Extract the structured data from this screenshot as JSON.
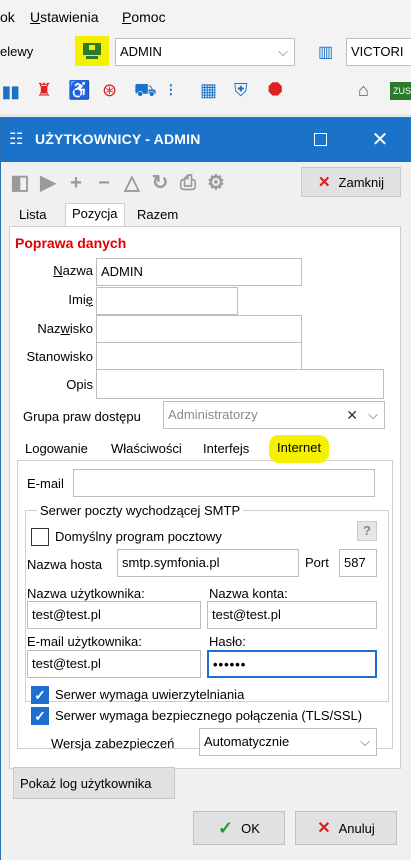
{
  "menubar": {
    "items": [
      "ok",
      "Ustawienia",
      "Pomoc"
    ],
    "underline_index": [
      null,
      0,
      0
    ]
  },
  "app_toolbar": {
    "left_label": "elewy",
    "user_select": "ADMIN",
    "company_select": "VICTORI"
  },
  "app_iconbar": {
    "icons": [
      "chart-icon",
      "extinguisher-icon",
      "accessibility-icon",
      "lifebuoy-icon",
      "car-icon",
      "footsteps-icon",
      "grid-icon",
      "shield-icon",
      "stop-sign-icon"
    ],
    "right_icons": [
      "bank-icon",
      "zus-icon"
    ]
  },
  "dialog": {
    "title": "UŻYTKOWNICY - ADMIN",
    "close_label": "Zamknij",
    "tabs": [
      "Lista",
      "Pozycja",
      "Razem"
    ],
    "active_tab": "Pozycja",
    "section_title": "Poprawa danych",
    "fields": {
      "nazwa": {
        "label": "Nazwa",
        "value": "ADMIN"
      },
      "imie": {
        "label": "Imię",
        "value": ""
      },
      "nazwisko": {
        "label": "Nazwisko",
        "value": ""
      },
      "stanowisko": {
        "label": "Stanowisko",
        "value": ""
      },
      "opis": {
        "label": "Opis",
        "value": ""
      }
    },
    "grupa": {
      "label": "Grupa praw dostępu",
      "value": "Administratorzy"
    },
    "subtabs": [
      "Logowanie",
      "Właściwości",
      "Interfejs",
      "Internet"
    ],
    "active_subtab": "Internet",
    "internet": {
      "email_label": "E-mail",
      "email_value": "",
      "smtp_group_title": "Serwer poczty wychodzącej SMTP",
      "default_client_label": "Domyślny program pocztowy",
      "help_label": "?",
      "host_label": "Nazwa hosta",
      "host_value": "smtp.symfonia.pl",
      "port_label": "Port",
      "port_value": "587",
      "username_label": "Nazwa użytkownika:",
      "username_value": "test@test.pl",
      "account_label": "Nazwa konta:",
      "account_value": "test@test.pl",
      "user_email_label": "E-mail użytkownika:",
      "user_email_value": "test@test.pl",
      "password_label": "Hasło:",
      "password_value": "••••••",
      "auth_required_label": "Serwer wymaga uwierzytelniania",
      "secure_required_label": "Serwer wymaga bezpiecznego połączenia (TLS/SSL)",
      "security_version_label": "Wersja zabezpieczeń",
      "security_version_value": "Automatycznie"
    },
    "show_log_label": "Pokaż log użytkownika",
    "ok_label": "OK",
    "cancel_label": "Anuluj"
  },
  "colors": {
    "accent": "#1a73c9",
    "highlight": "#f4f000",
    "section_title": "#e00000",
    "check_ok": "#1e9e2e",
    "cancel_x": "#d32020"
  }
}
